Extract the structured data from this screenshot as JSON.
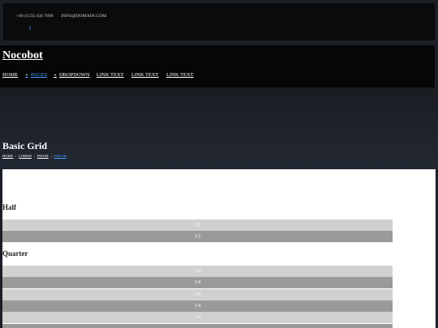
{
  "topbar": {
    "phone": "+00 (123) 456 7890",
    "email": "INFO@DOMAIN.COM",
    "social_icon": "pause-icon"
  },
  "nav": {
    "brand": "Nocobot",
    "items": [
      {
        "label": "HOME"
      },
      {
        "label": "PAGES"
      },
      {
        "label": "DROPDOWN"
      },
      {
        "label": "LINK TEXT"
      },
      {
        "label": "LINK TEXT"
      },
      {
        "label": "LINK TEXT"
      }
    ]
  },
  "hero": {
    "title": "Basic Grid",
    "breadcrumbs": [
      "HOME",
      "LOREM",
      "IPSUM",
      "DOLOR"
    ]
  },
  "content": {
    "half": {
      "title": "Half",
      "rows": [
        "1/2",
        "1/2"
      ]
    },
    "quarter": {
      "title": "Quarter",
      "rows": [
        "1/4",
        "1/4",
        "1/4",
        "1/4",
        "1/4"
      ]
    }
  },
  "colors": {
    "accent": "#4aa0ff",
    "grid_light": "#d0d0d0",
    "grid_dark": "#9a9a9a"
  }
}
